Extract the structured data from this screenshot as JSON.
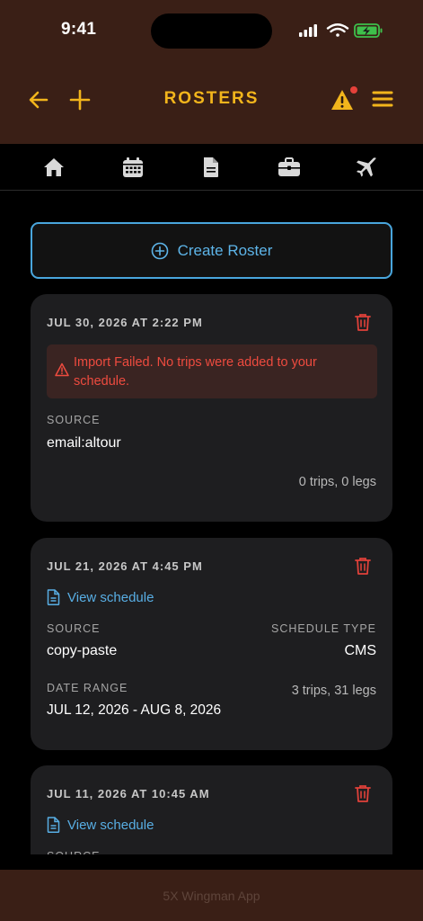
{
  "status_bar": {
    "time": "9:41"
  },
  "header": {
    "title": "ROSTERS",
    "accent": "#f2b51c",
    "background": "#3a1f16"
  },
  "tabs": [
    {
      "icon": "home-icon"
    },
    {
      "icon": "calendar-icon"
    },
    {
      "icon": "document-icon"
    },
    {
      "icon": "briefcase-icon"
    },
    {
      "icon": "airplane-icon"
    }
  ],
  "create_roster": {
    "label": "Create Roster"
  },
  "rosters": [
    {
      "date": "JUL 30, 2026 AT 2:22 PM",
      "error": "Import Failed. No trips were added to your schedule.",
      "source_label": "SOURCE",
      "source": "email:altour",
      "counts": "0 trips, 0 legs"
    },
    {
      "date": "JUL 21, 2026 AT 4:45 PM",
      "view_schedule": "View schedule",
      "source_label": "SOURCE",
      "source": "copy-paste",
      "schedule_type_label": "SCHEDULE TYPE",
      "schedule_type": "CMS",
      "date_range_label": "DATE RANGE",
      "date_range": "JUL 12, 2026 - AUG 8, 2026",
      "counts": "3 trips, 31 legs"
    },
    {
      "date": "JUL 11, 2026 AT 10:45 AM",
      "view_schedule": "View schedule",
      "source_label": "SOURCE"
    }
  ],
  "footer": {
    "text": "5X Wingman App"
  }
}
